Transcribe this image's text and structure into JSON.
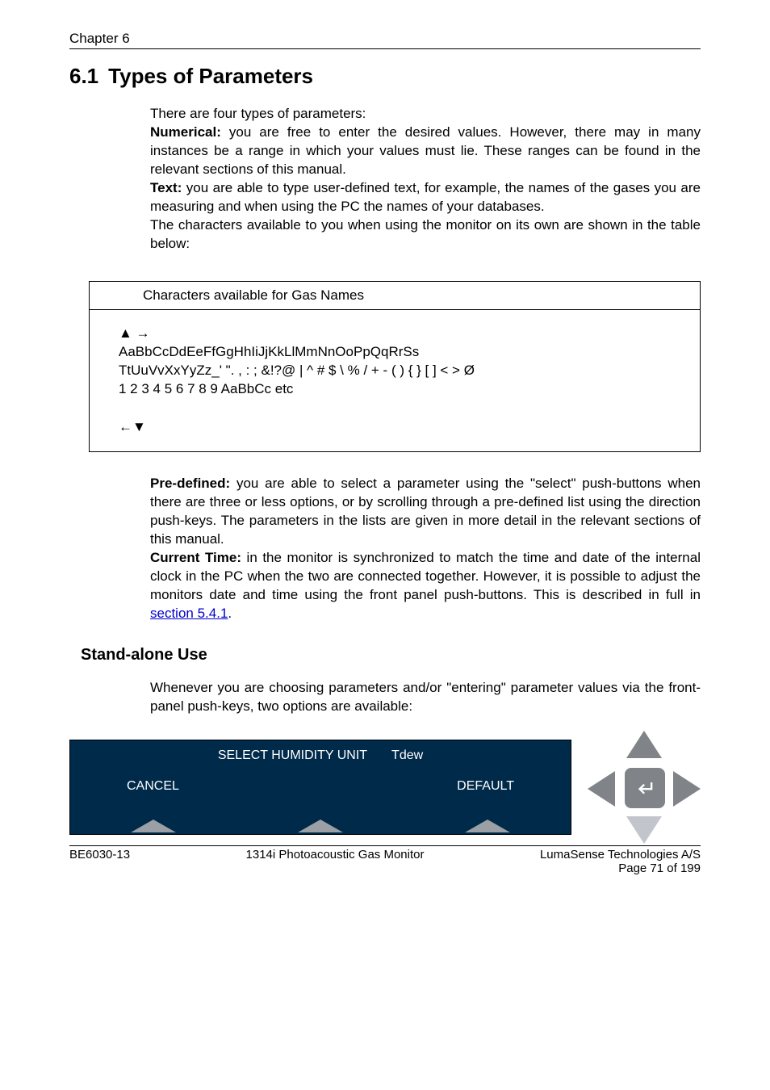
{
  "header": {
    "chapter": "Chapter 6"
  },
  "section": {
    "number": "6.1",
    "title": "Types of Parameters"
  },
  "intro": "There are four types of parameters:",
  "numerical": {
    "label": "Numerical:",
    "text": " you are free to enter the desired values. However, there may in many instances be a range in which your values must lie. These ranges can be found in the relevant sections of this manual."
  },
  "text_param": {
    "label": "Text:",
    "text": " you are able to type user-defined text, for example, the names of the gases you are measuring and when using the PC the names of your databases."
  },
  "chars_intro": "The characters available to you when using the monitor on its own are shown in the table below:",
  "char_table": {
    "header": "Characters available for Gas Names",
    "lines": [
      "▲ →",
      "AaBbCcDdEeFfGgHhIiJjKkLlMmNnOoPpQqRrSs",
      "TtUuVvXxYyZz_' \". , : ; &!?@ | ^ # $ \\ % / + - ( ) { } [ ] < > Ø",
      "1 2 3 4 5 6 7 8 9   AaBbCc   etc"
    ],
    "bottom_arrows": "←▼"
  },
  "predefined": {
    "label": "Pre-defined:",
    "text": " you are able to select a parameter using the \"select\" push-buttons when there are three or less options, or by scrolling through a pre-defined list using the direction push-keys. The parameters in the lists are given in more detail in the relevant sections of this manual."
  },
  "current_time": {
    "label": "Current Time:",
    "text_before_link": " in the monitor is synchronized to match the time and date of the internal clock in the PC when the two are connected together. However, it is possible to adjust the monitors date and time using the front panel push-buttons. This is described in full in ",
    "link_text": "section 5.4.1",
    "text_after_link": "."
  },
  "standalone": {
    "heading": "Stand-alone Use",
    "para": "Whenever you are choosing parameters and/or \"entering\" parameter values via the front-panel push-keys, two options are available:"
  },
  "display": {
    "top_left": "SELECT HUMIDITY UNIT",
    "top_right": "Tdew",
    "btn_cancel": "CANCEL",
    "btn_default": "DEFAULT"
  },
  "footer": {
    "left": "BE6030-13",
    "center": "1314i Photoacoustic Gas Monitor",
    "right_line1": "LumaSense Technologies A/S",
    "right_line2": "Page 71 of 199"
  }
}
